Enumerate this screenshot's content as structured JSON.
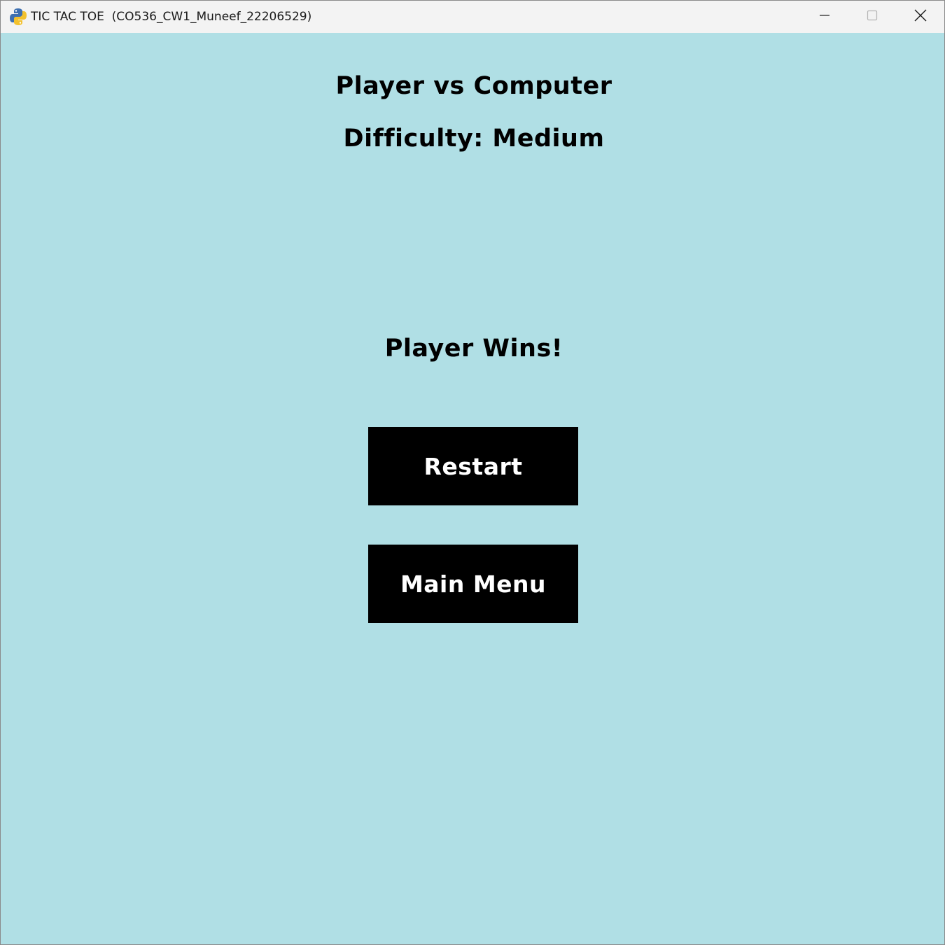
{
  "window": {
    "title": "TIC TAC TOE  (CO536_CW1_Muneef_22206529)",
    "app_icon": "python-snake-icon",
    "controls": {
      "minimize_icon": "minimize-icon",
      "maximize_icon": "maximize-icon",
      "close_icon": "close-icon"
    }
  },
  "screen": {
    "mode_title": "Player vs Computer",
    "difficulty": "Difficulty: Medium",
    "result": "Player Wins!",
    "buttons": {
      "restart": "Restart",
      "main_menu": "Main Menu"
    }
  },
  "colors": {
    "background": "#b0dfe5",
    "button_bg": "#000000",
    "button_text": "#ffffff",
    "text": "#000000",
    "titlebar": "#f3f3f3"
  }
}
